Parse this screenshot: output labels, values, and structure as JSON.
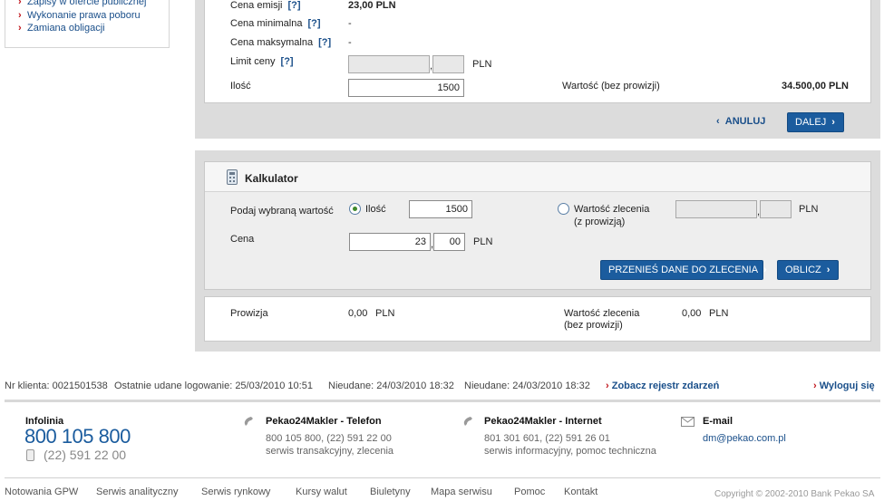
{
  "sidebar": {
    "items": [
      {
        "label": "Zapisy w ofercie publicznej"
      },
      {
        "label": "Wykonanie prawa poboru"
      },
      {
        "label": "Zamiana obligacji"
      }
    ]
  },
  "order": {
    "cena_emisji_label": "Cena emisji",
    "cena_emisji_value": "23,00 PLN",
    "cena_min_label": "Cena minimalna",
    "cena_min_value": "-",
    "cena_max_label": "Cena maksymalna",
    "cena_max_value": "-",
    "limit_label": "Limit ceny",
    "limit_currency": "PLN",
    "ilosc_label": "Ilość",
    "ilosc_value": "1500",
    "wartosc_label": "Wartość (bez prowizji)",
    "wartosc_value": "34.500,00 PLN",
    "help": "[?]",
    "anuluj_label": "ANULUJ",
    "dalej_label": "DALEJ"
  },
  "calculator": {
    "title": "Kalkulator",
    "podaj_label": "Podaj wybraną wartość",
    "ilosc_option": "Ilość",
    "ilosc_value": "1500",
    "wartosc_option_line1": "Wartość zlecenia",
    "wartosc_option_line2": "(z prowizją)",
    "wartosc_currency": "PLN",
    "cena_label": "Cena",
    "cena_int": "23",
    "cena_dec": "00",
    "cena_currency": "PLN",
    "przenies_label": "PRZENIEŚ DANE DO ZLECENIA",
    "oblicz_label": "OBLICZ"
  },
  "result": {
    "prowizja_label": "Prowizja",
    "prowizja_value": "0,00",
    "prowizja_currency": "PLN",
    "wartosc_label_line1": "Wartość zlecenia",
    "wartosc_label_line2": "(bez prowizji)",
    "wartosc_value": "0,00",
    "wartosc_currency": "PLN"
  },
  "status": {
    "nr_klienta": "Nr klienta: 0021501538",
    "ostatnie": "Ostatnie udane logowanie:  25/03/2010 10:51",
    "nieudane1": "Nieudane: 24/03/2010 18:32",
    "nieudane2": "Nieudane: 24/03/2010 18:32",
    "rejestr_link": "Zobacz rejestr zdarzeń",
    "wyloguj_link": "Wyloguj się"
  },
  "footer": {
    "infolinia_title": "Infolinia",
    "infolinia_phone": "800 105 800",
    "infolinia_mobile": "(22) 591 22 00",
    "telefon_title": "Pekao24Makler - Telefon",
    "telefon_numbers": "800 105 800, (22) 591 22 00",
    "telefon_desc": "serwis transakcyjny, zlecenia",
    "internet_title": "Pekao24Makler - Internet",
    "internet_numbers": "801 301 601, (22) 591 26 01",
    "internet_desc": "serwis informacyjny, pomoc techniczna",
    "email_title": "E-mail",
    "email_value": "dm@pekao.com.pl",
    "links": [
      "Notowania GPW",
      "Serwis analityczny",
      "Serwis rynkowy",
      "Kursy walut",
      "Biuletyny",
      "Mapa serwisu",
      "Pomoc",
      "Kontakt"
    ],
    "copyright": "Copyright © 2002-2010 Bank Pekao SA"
  },
  "colors": {
    "accent_blue": "#1b5c9e",
    "link_blue": "#1a4f8a",
    "chevron_red": "#c0141b",
    "panel_grey": "#dcdcdc"
  }
}
